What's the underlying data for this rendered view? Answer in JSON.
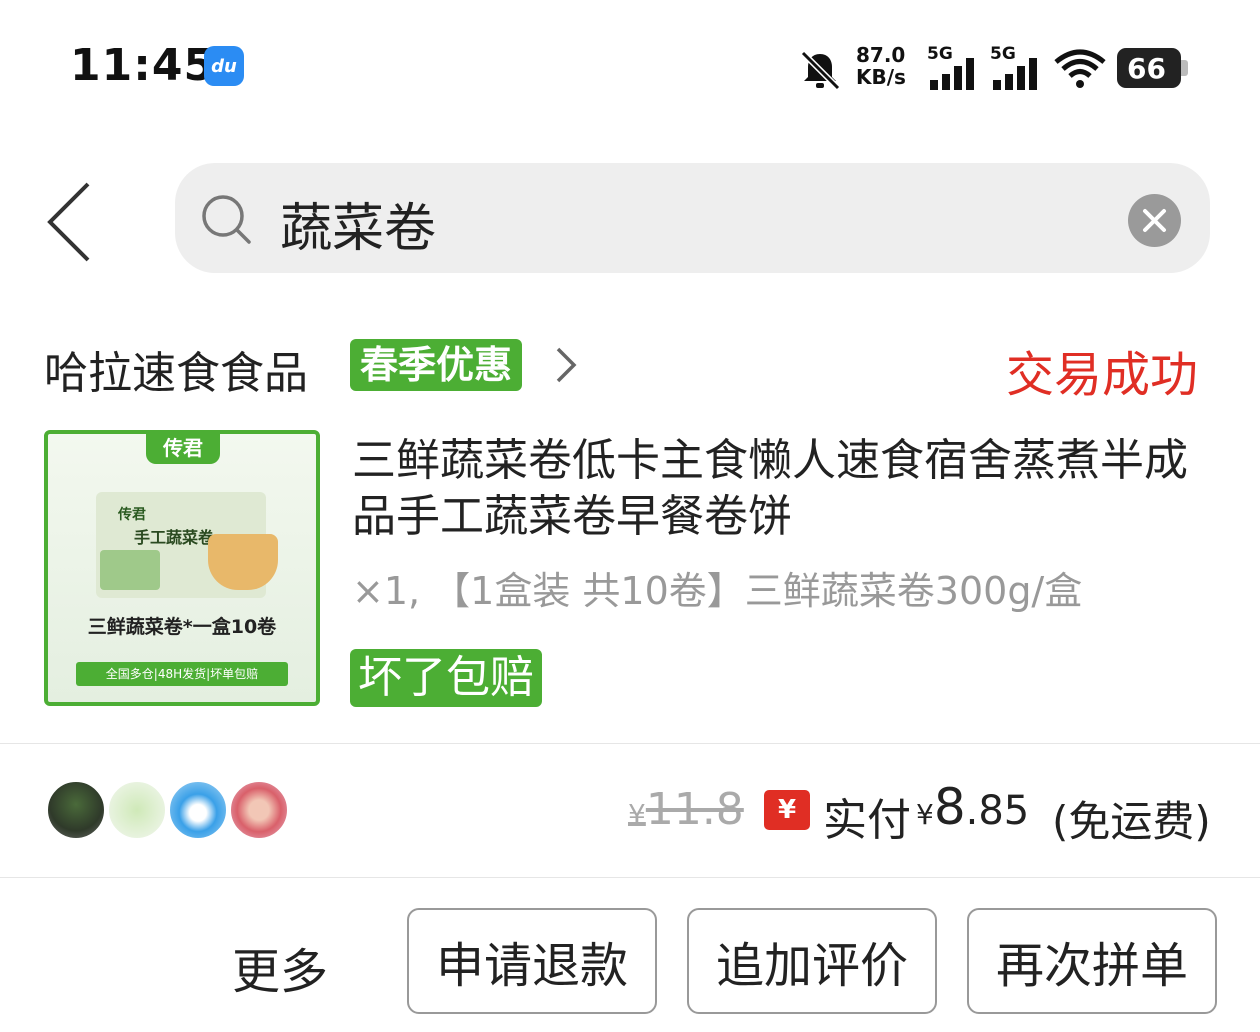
{
  "status_bar": {
    "time": "11:45",
    "app_icon_label": "du",
    "net_speed_value": "87.0",
    "net_speed_unit": "KB/s",
    "signal1_label": "5G",
    "signal2_label": "5G",
    "battery": "66",
    "icons": [
      "mute-icon",
      "signal-icon",
      "wifi-icon",
      "battery-icon"
    ]
  },
  "search": {
    "query": "蔬菜卷",
    "icons": [
      "back-icon",
      "search-icon",
      "clear-icon"
    ]
  },
  "store": {
    "name": "哈拉速食食品",
    "promo_badge": "春季优惠",
    "order_status": "交易成功"
  },
  "product": {
    "thumb_brand": "传君",
    "thumb_package_brand": "传君",
    "thumb_package_name": "手工蔬菜卷",
    "thumb_caption": "三鲜蔬菜卷*一盒10卷",
    "thumb_footer": "全国多仓|48H发货|坏单包赔",
    "title": "三鲜蔬菜卷低卡主食懒人速食宿舍蒸煮半成品手工蔬菜卷早餐卷饼",
    "spec": "×1, 【1盒装 共10卷】三鲜蔬菜卷300g/盒",
    "guarantee_badge": "坏了包赔"
  },
  "price": {
    "original_currency": "¥",
    "original": "11.8",
    "pay_icon_label": "¥",
    "paid_label": "实付",
    "paid_currency": "¥",
    "paid_integer": "8",
    "paid_decimal": ".85",
    "paid_note": "(免运费)"
  },
  "actions": {
    "more": "更多",
    "refund": "申请退款",
    "review": "追加评价",
    "regroup": "再次拼单"
  },
  "colors": {
    "accent_green": "#4cae34",
    "status_red": "#e02e24",
    "search_bg": "#eeeeee"
  }
}
